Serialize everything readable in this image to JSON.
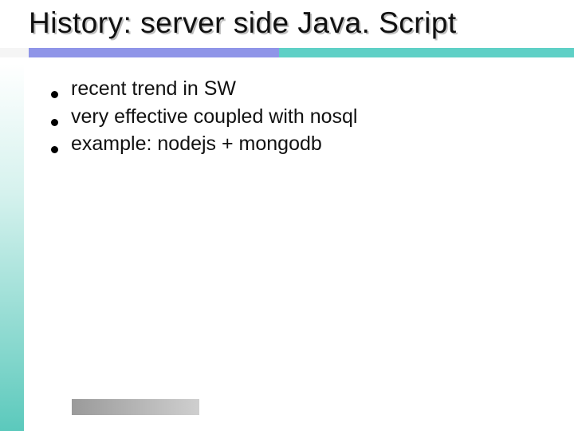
{
  "title": "History: server side Java. Script",
  "bullets": [
    "recent trend in SW",
    "very effective coupled with nosql",
    "example: nodejs + mongodb"
  ],
  "colors": {
    "accent_blue": "#8f95e8",
    "accent_teal": "#5fd0c6",
    "footer_gray": "#9a9a9a"
  }
}
